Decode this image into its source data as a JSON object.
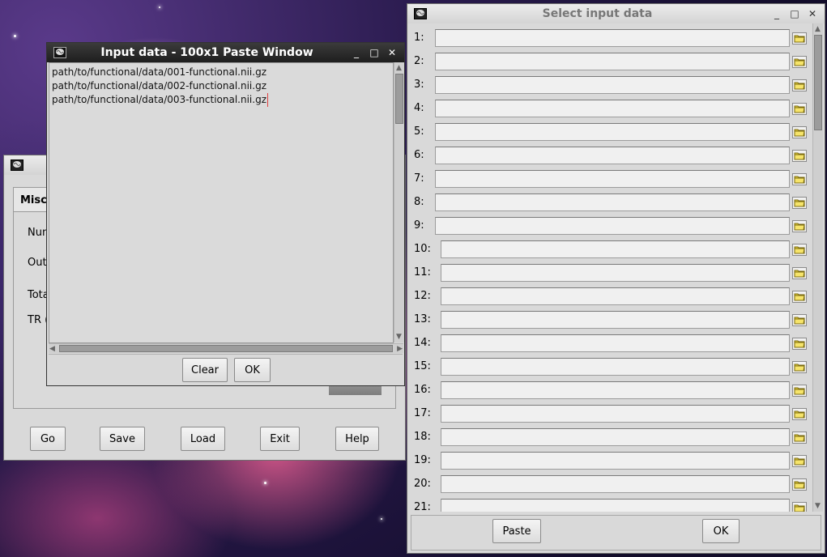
{
  "background_window": {
    "tab_label": "Misc",
    "row_labels": [
      "Num",
      "Outp",
      "Tota",
      "TR ("
    ],
    "buttons": [
      "Go",
      "Save",
      "Load",
      "Exit",
      "Help"
    ]
  },
  "paste_window": {
    "title": "Input data - 100x1 Paste Window",
    "lines": [
      "path/to/functional/data/001-functional.nii.gz",
      "path/to/functional/data/002-functional.nii.gz",
      "path/to/functional/data/003-functional.nii.gz"
    ],
    "clear_label": "Clear",
    "ok_label": "OK"
  },
  "select_window": {
    "title": "Select input data",
    "rows": [
      "1:",
      "2:",
      "3:",
      "4:",
      "5:",
      "6:",
      "7:",
      "8:",
      "9:",
      "10:",
      "11:",
      "12:",
      "13:",
      "14:",
      "15:",
      "16:",
      "17:",
      "18:",
      "19:",
      "20:",
      "21:"
    ],
    "paste_label": "Paste",
    "ok_label": "OK"
  },
  "window_controls": {
    "minimize": "_",
    "maximize": "□",
    "close": "✕"
  },
  "icons": {
    "window_icon": "brain-icon",
    "browse": "folder-icon"
  },
  "colors": {
    "window_bg": "#d9d9d9",
    "active_title": "#2b2b2b",
    "field_bg": "#f0f0f0"
  }
}
